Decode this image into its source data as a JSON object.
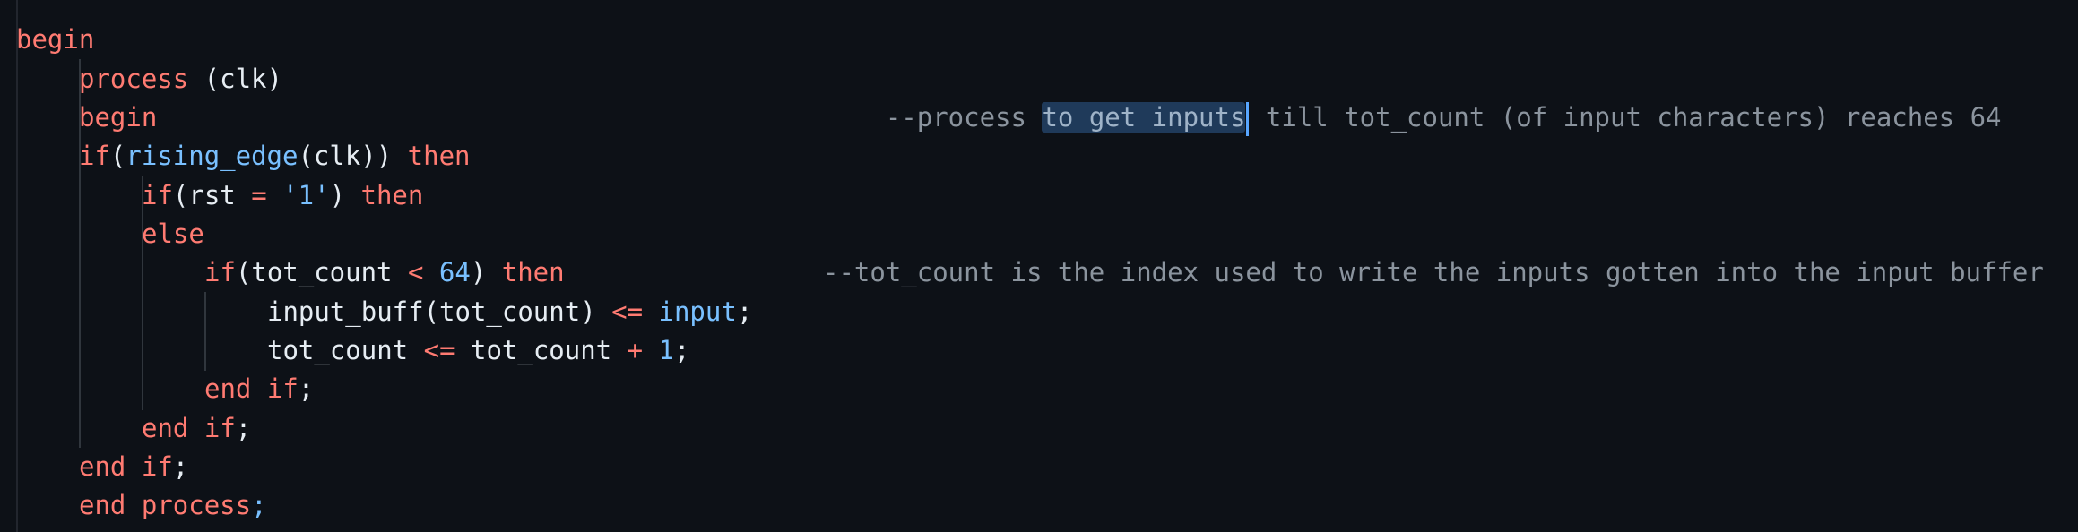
{
  "editor": {
    "lines": [
      {
        "tokens": [
          {
            "t": "begin",
            "c": "kw"
          }
        ]
      },
      {
        "tokens": [
          {
            "t": "process",
            "c": "kw"
          },
          {
            "t": " (clk)",
            "c": "id"
          }
        ]
      },
      {
        "tokens": [
          {
            "t": "begin",
            "c": "kw"
          }
        ]
      },
      {
        "tokens": [
          {
            "t": "if",
            "c": "kw"
          },
          {
            "t": "(",
            "c": "id"
          },
          {
            "t": "rising_edge",
            "c": "fn"
          },
          {
            "t": "(clk)) ",
            "c": "id"
          },
          {
            "t": "then",
            "c": "kw"
          }
        ]
      },
      {
        "tokens": [
          {
            "t": "if",
            "c": "kw"
          },
          {
            "t": "(rst ",
            "c": "id"
          },
          {
            "t": "=",
            "c": "op"
          },
          {
            "t": " ",
            "c": "id"
          },
          {
            "t": "'1'",
            "c": "num"
          },
          {
            "t": ") ",
            "c": "id"
          },
          {
            "t": "then",
            "c": "kw"
          }
        ]
      },
      {
        "tokens": [
          {
            "t": "else",
            "c": "kw"
          }
        ]
      },
      {
        "tokens": [
          {
            "t": "if",
            "c": "kw"
          },
          {
            "t": "(tot_count ",
            "c": "id"
          },
          {
            "t": "<",
            "c": "op"
          },
          {
            "t": " ",
            "c": "id"
          },
          {
            "t": "64",
            "c": "num"
          },
          {
            "t": ") ",
            "c": "id"
          },
          {
            "t": "then",
            "c": "kw"
          }
        ]
      },
      {
        "tokens": [
          {
            "t": "input_buff(tot_count) ",
            "c": "id"
          },
          {
            "t": "<=",
            "c": "op"
          },
          {
            "t": " ",
            "c": "id"
          },
          {
            "t": "input",
            "c": "fn"
          },
          {
            "t": ";",
            "c": "id"
          }
        ]
      },
      {
        "tokens": [
          {
            "t": "tot_count ",
            "c": "id"
          },
          {
            "t": "<=",
            "c": "op"
          },
          {
            "t": " tot_count ",
            "c": "id"
          },
          {
            "t": "+",
            "c": "op"
          },
          {
            "t": " ",
            "c": "id"
          },
          {
            "t": "1",
            "c": "num"
          },
          {
            "t": ";",
            "c": "id"
          }
        ]
      },
      {
        "tokens": [
          {
            "t": "end",
            "c": "kw"
          },
          {
            "t": " ",
            "c": "id"
          },
          {
            "t": "if",
            "c": "kw"
          },
          {
            "t": ";",
            "c": "id"
          }
        ]
      },
      {
        "tokens": [
          {
            "t": "end",
            "c": "kw"
          },
          {
            "t": " ",
            "c": "id"
          },
          {
            "t": "if",
            "c": "kw"
          },
          {
            "t": ";",
            "c": "id"
          }
        ]
      },
      {
        "tokens": [
          {
            "t": "end",
            "c": "kw"
          },
          {
            "t": " ",
            "c": "id"
          },
          {
            "t": "if",
            "c": "kw"
          },
          {
            "t": ";",
            "c": "id"
          }
        ]
      },
      {
        "tokens": [
          {
            "t": "end",
            "c": "kw"
          },
          {
            "t": " ",
            "c": "id"
          },
          {
            "t": "process",
            "c": "kw"
          },
          {
            "t": ";",
            "c": "fn"
          }
        ]
      }
    ],
    "comment1": {
      "before": "--process ",
      "selected": "to get inputs",
      "after": " till tot_count (of input characters) reaches 64"
    },
    "comment2": "--tot_count is the index used to write the inputs gotten into the input buffer"
  }
}
